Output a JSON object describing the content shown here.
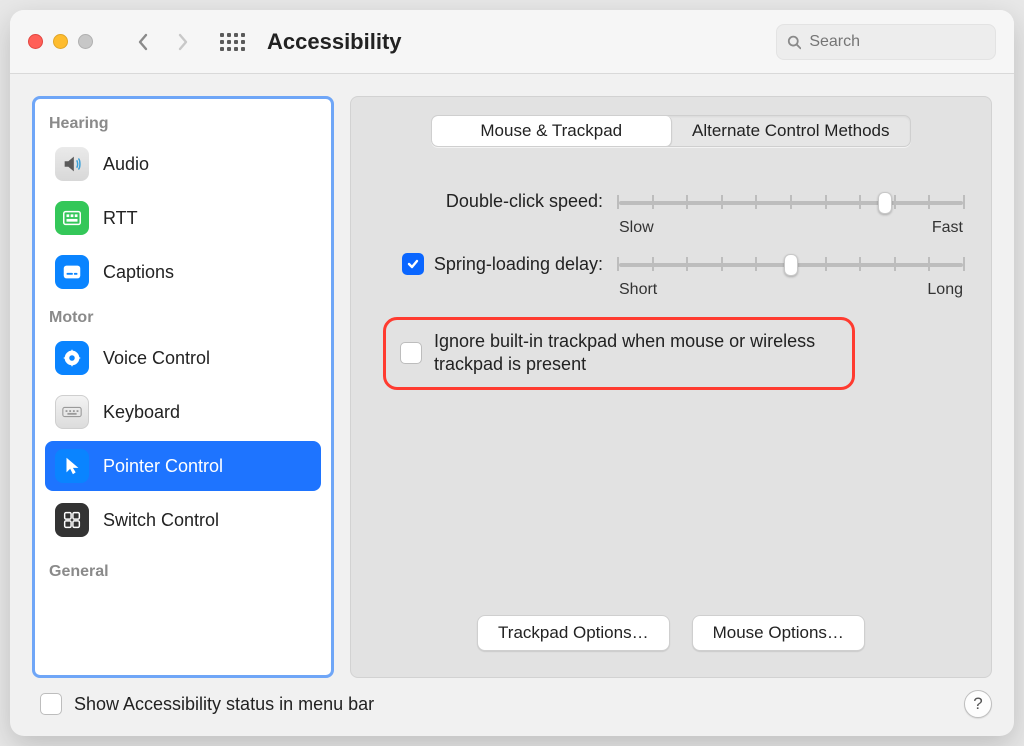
{
  "header": {
    "title": "Accessibility",
    "search_placeholder": "Search"
  },
  "sidebar": {
    "sections": {
      "hearing": "Hearing",
      "motor": "Motor",
      "general": "General"
    },
    "items": {
      "audio": {
        "label": "Audio"
      },
      "rtt": {
        "label": "RTT"
      },
      "captions": {
        "label": "Captions"
      },
      "voice": {
        "label": "Voice Control"
      },
      "keyboard": {
        "label": "Keyboard"
      },
      "pointer": {
        "label": "Pointer Control"
      },
      "switch": {
        "label": "Switch Control"
      }
    }
  },
  "tabs": {
    "mouse": "Mouse & Trackpad",
    "alt": "Alternate Control Methods"
  },
  "main": {
    "double_click": {
      "label": "Double-click speed:",
      "min": "Slow",
      "max": "Fast",
      "value_pct": 77
    },
    "spring_loading": {
      "checked": true,
      "label": "Spring-loading delay:",
      "min": "Short",
      "max": "Long",
      "value_pct": 50
    },
    "ignore_trackpad": {
      "checked": false,
      "label": "Ignore built-in trackpad when mouse or wireless trackpad is present"
    },
    "buttons": {
      "trackpad": "Trackpad Options…",
      "mouse": "Mouse Options…"
    }
  },
  "footer": {
    "show_status": {
      "checked": false,
      "label": "Show Accessibility status in menu bar"
    },
    "help": "?"
  }
}
